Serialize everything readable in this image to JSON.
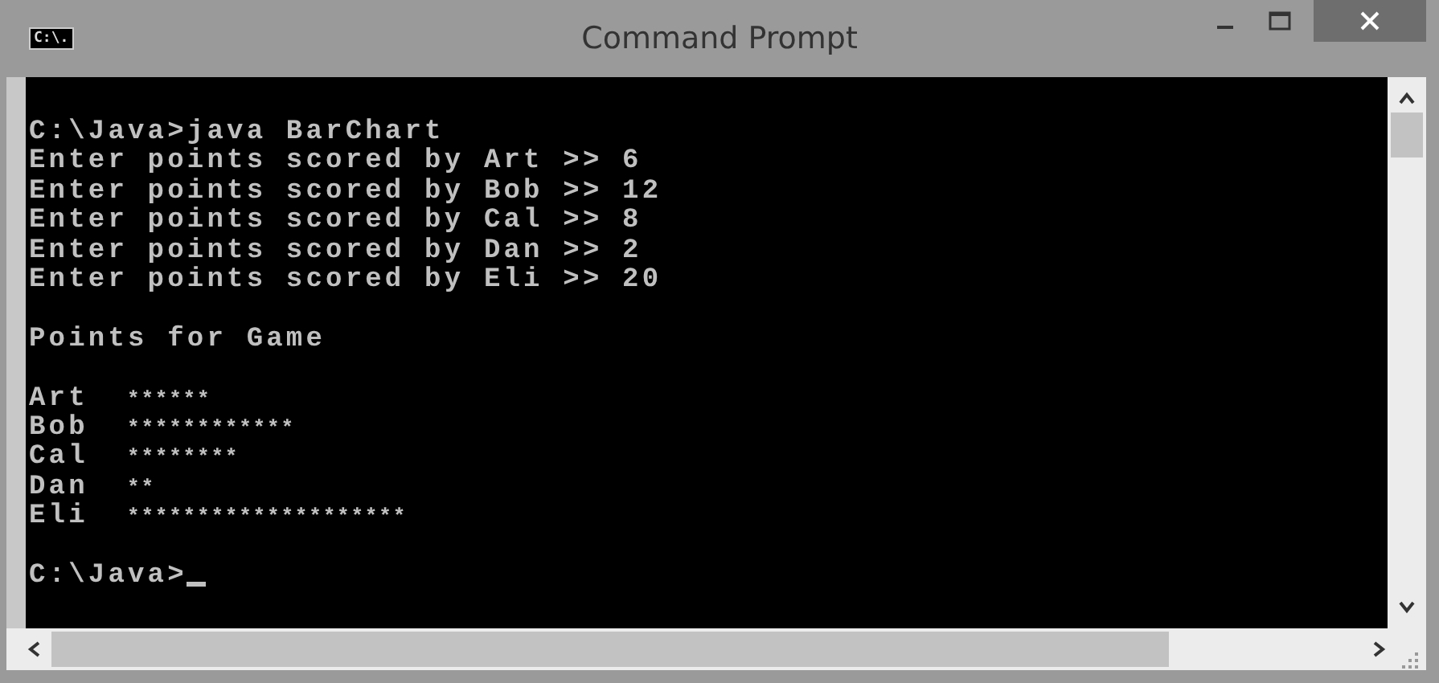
{
  "window": {
    "title": "Command Prompt",
    "icon_text": "C:\\."
  },
  "console": {
    "blocks": [
      [
        "C:\\Java>java BarChart",
        "Enter points scored by Art >> 6",
        "Enter points scored by Bob >> 12",
        "Enter points scored by Cal >> 8",
        "Enter points scored by Dan >> 2",
        "Enter points scored by Eli >> 20"
      ],
      [
        "Points for Game"
      ]
    ]
  },
  "bars": [
    {
      "name": "Art",
      "stars": "******"
    },
    {
      "name": "Bob",
      "stars": "************"
    },
    {
      "name": "Cal",
      "stars": "********"
    },
    {
      "name": "Dan",
      "stars": "**"
    },
    {
      "name": "Eli",
      "stars": "********************"
    }
  ],
  "prompt": "C:\\Java>"
}
